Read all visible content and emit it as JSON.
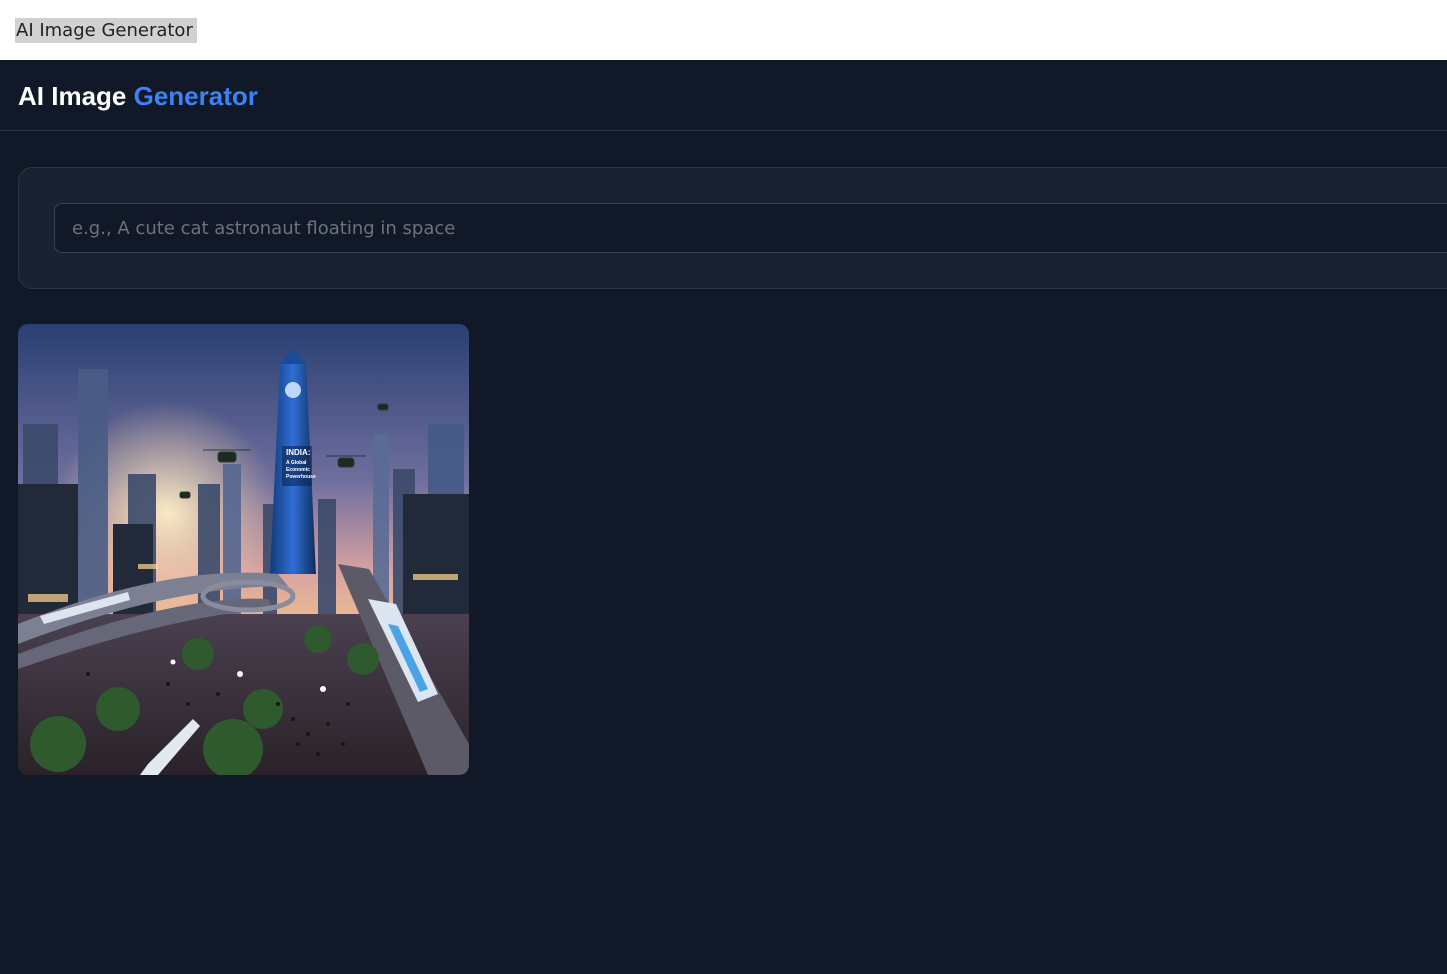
{
  "browser": {
    "tab_title": "AI Image Generator"
  },
  "header": {
    "title_main": "AI Image",
    "title_accent": "Generator"
  },
  "prompt": {
    "placeholder": "e.g., A cute cat astronaut floating in space",
    "value": ""
  },
  "gallery": {
    "images": [
      {
        "billboard_lines": [
          "INDIA:",
          "A Global",
          "Economic",
          "Powerhouse"
        ]
      }
    ]
  },
  "colors": {
    "background": "#111827",
    "card": "#192230",
    "accent": "#3b82f6",
    "text": "#ffffff"
  }
}
